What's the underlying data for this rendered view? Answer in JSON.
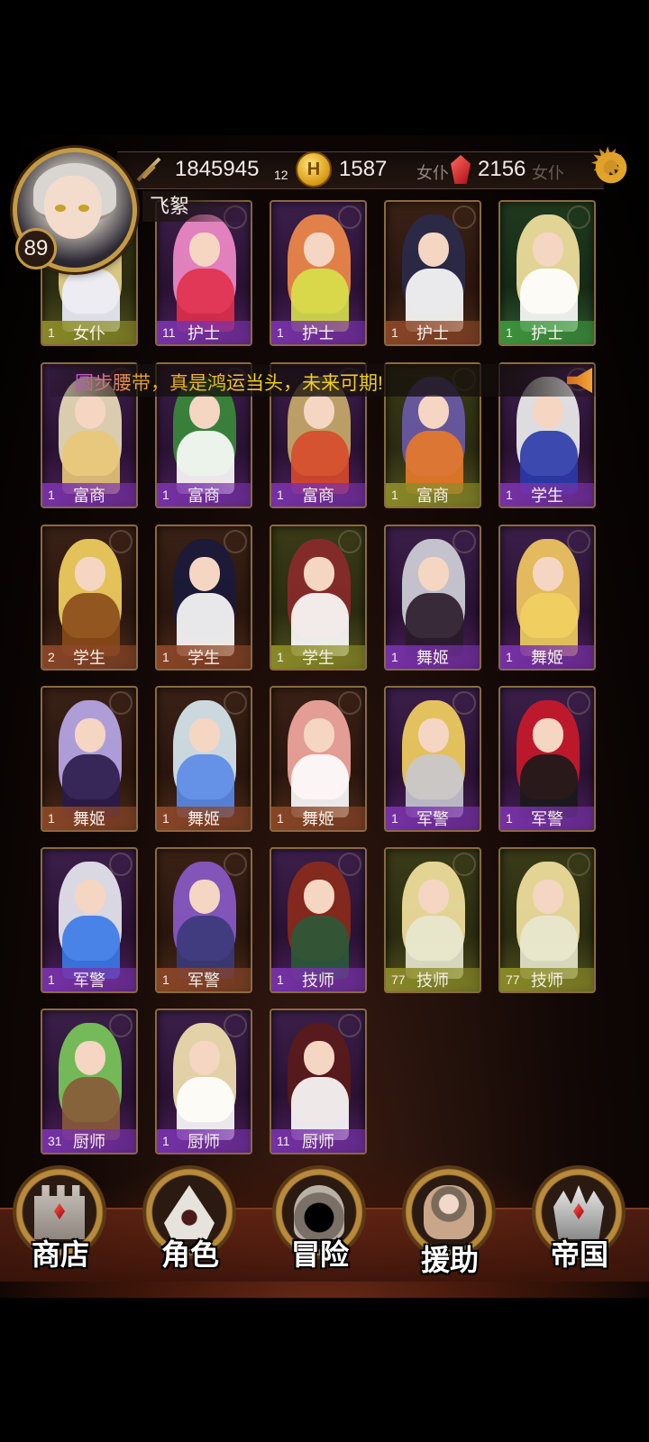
{
  "player": {
    "name": "飞絮",
    "level": "89"
  },
  "resources": {
    "power": "1845945",
    "gold": "1587",
    "gems": "2156",
    "partial_count": "12"
  },
  "marquee": {
    "text": "圆步腰带，真是鸿运当头，未来可期!"
  },
  "cards": [
    {
      "count": "1",
      "job": "女仆",
      "frame": "olive"
    },
    {
      "count": "11",
      "job": "护士",
      "frame": "purple"
    },
    {
      "count": "1",
      "job": "护士",
      "frame": "purple"
    },
    {
      "count": "1",
      "job": "护士",
      "frame": "brown"
    },
    {
      "count": "1",
      "job": "护士",
      "frame": "green"
    },
    {
      "count": "1",
      "job": "富商",
      "frame": "purple"
    },
    {
      "count": "1",
      "job": "富商",
      "frame": "purple"
    },
    {
      "count": "1",
      "job": "富商",
      "frame": "purple"
    },
    {
      "count": "1",
      "job": "富商",
      "frame": "olive"
    },
    {
      "count": "1",
      "job": "学生",
      "frame": "purple"
    },
    {
      "count": "2",
      "job": "学生",
      "frame": "brown"
    },
    {
      "count": "1",
      "job": "学生",
      "frame": "brown"
    },
    {
      "count": "1",
      "job": "学生",
      "frame": "olive"
    },
    {
      "count": "1",
      "job": "舞姬",
      "frame": "purple"
    },
    {
      "count": "1",
      "job": "舞姬",
      "frame": "purple"
    },
    {
      "count": "1",
      "job": "舞姬",
      "frame": "brown"
    },
    {
      "count": "1",
      "job": "舞姬",
      "frame": "brown"
    },
    {
      "count": "1",
      "job": "舞姬",
      "frame": "brown"
    },
    {
      "count": "1",
      "job": "军警",
      "frame": "purple"
    },
    {
      "count": "1",
      "job": "军警",
      "frame": "purple"
    },
    {
      "count": "1",
      "job": "军警",
      "frame": "purple"
    },
    {
      "count": "1",
      "job": "军警",
      "frame": "brown"
    },
    {
      "count": "1",
      "job": "技师",
      "frame": "purple"
    },
    {
      "count": "77",
      "job": "技师",
      "frame": "olive"
    },
    {
      "count": "77",
      "job": "技师",
      "frame": "olive"
    },
    {
      "count": "31",
      "job": "厨师",
      "frame": "purple"
    },
    {
      "count": "1",
      "job": "厨师",
      "frame": "purple"
    },
    {
      "count": "11",
      "job": "厨师",
      "frame": "purple"
    }
  ],
  "ghost_labels": {
    "maid_1": "女仆",
    "maid_2": "女仆"
  },
  "nav": [
    {
      "label": "商店",
      "icon": "castle-icon"
    },
    {
      "label": "角色",
      "icon": "hood-icon"
    },
    {
      "label": "冒险",
      "icon": "cave-icon"
    },
    {
      "label": "援助",
      "icon": "girl-icon"
    },
    {
      "label": "帝国",
      "icon": "crown-icon"
    }
  ]
}
